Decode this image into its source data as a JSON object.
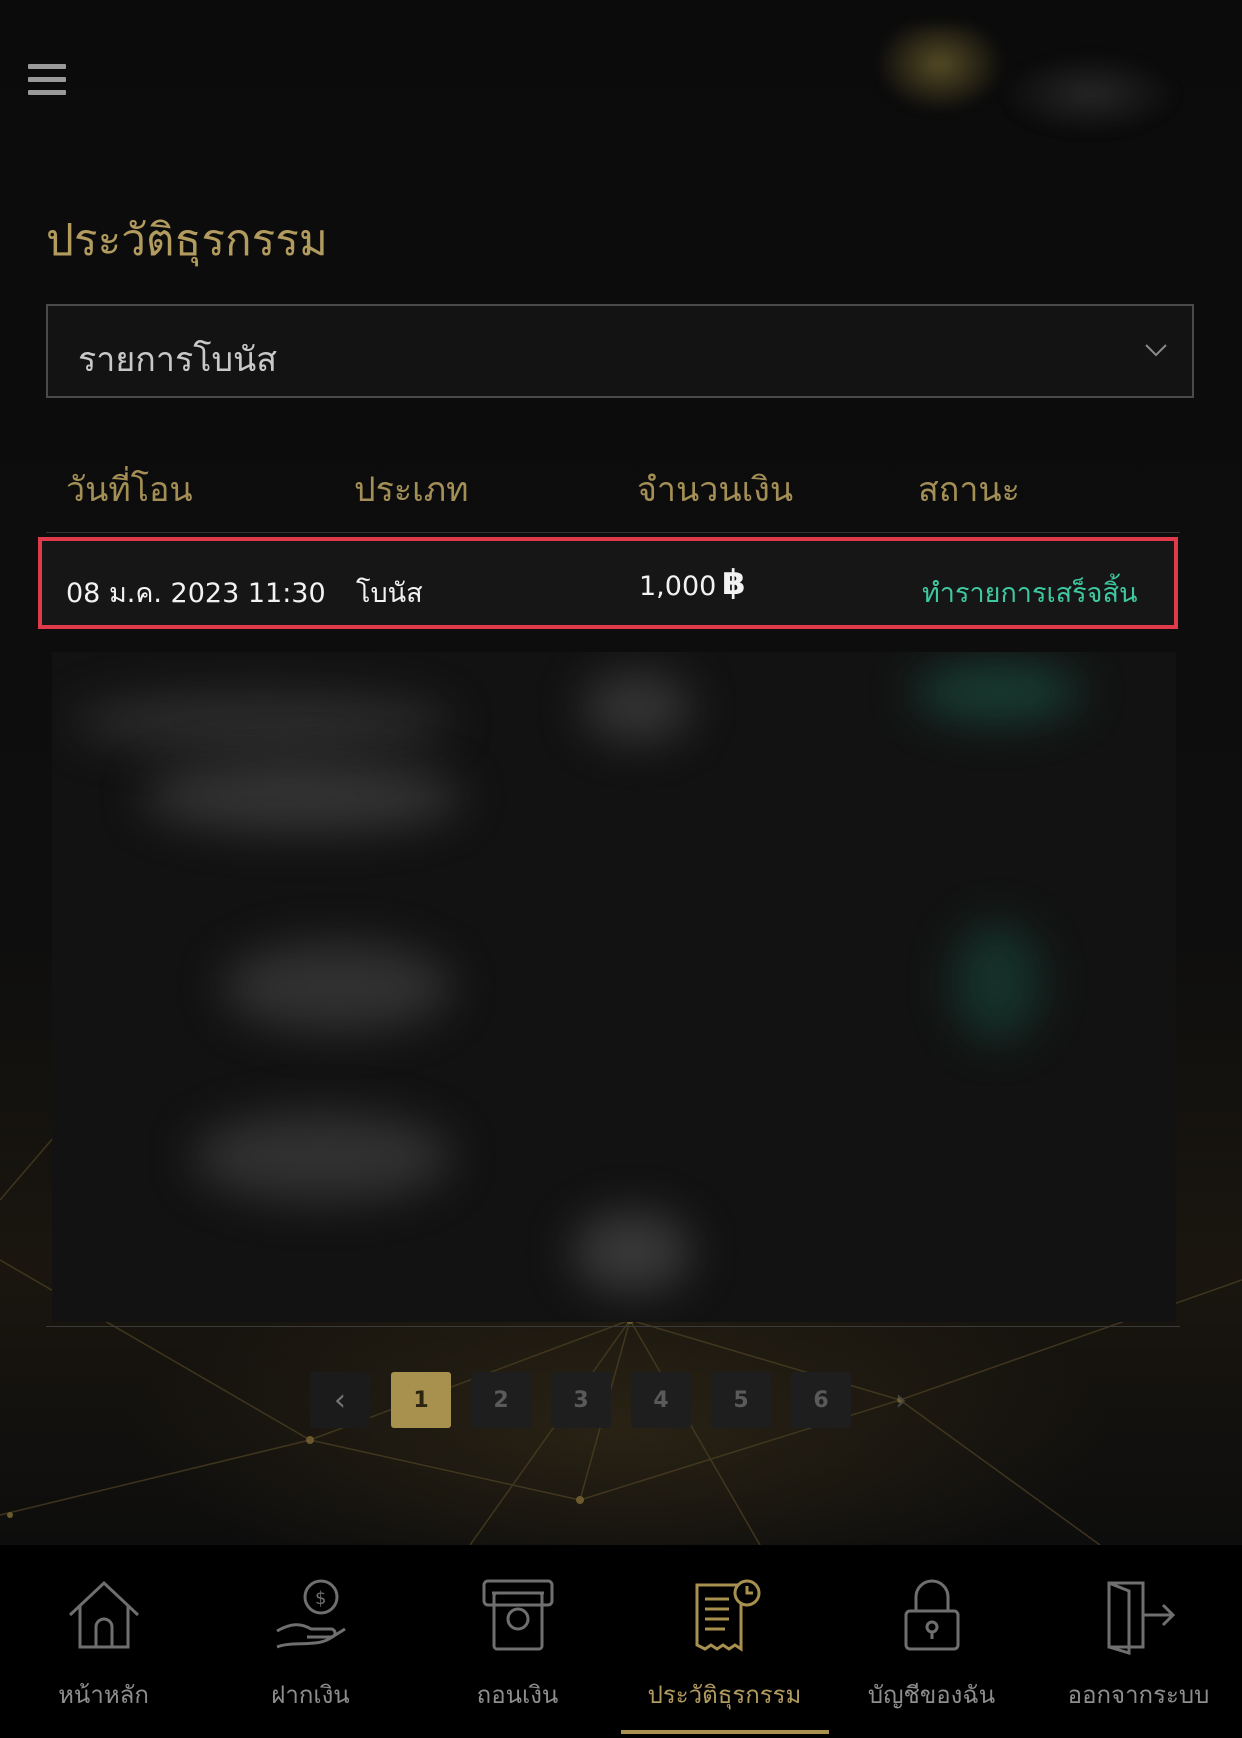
{
  "page_title": "ประวัติธุรกรรม",
  "filter": {
    "selected": "รายการโบนัส"
  },
  "table": {
    "headers": [
      "วันที่โอน",
      "ประเภท",
      "จำนวนเงิน",
      "สถานะ"
    ],
    "rows": [
      {
        "date": "08 ม.ค. 2023 11:30",
        "type": "โบนัส",
        "amount": "1,000",
        "currency": "฿",
        "status": "ทำรายการเสร็จสิ้น"
      }
    ]
  },
  "pagination": {
    "prev": "‹",
    "pages": [
      "1",
      "2",
      "3",
      "4",
      "5",
      "6"
    ],
    "current": "1",
    "next": "›"
  },
  "bottom_nav": [
    {
      "label": "หน้าหลัก",
      "icon": "home-icon"
    },
    {
      "label": "ฝากเงิน",
      "icon": "deposit-coin-hand-icon"
    },
    {
      "label": "ถอนเงิน",
      "icon": "withdraw-atm-icon"
    },
    {
      "label": "ประวัติธุรกรรม",
      "icon": "transaction-history-receipt-icon",
      "active": true
    },
    {
      "label": "บัญชีของฉัน",
      "icon": "account-lock-icon"
    },
    {
      "label": "ออกจากระบบ",
      "icon": "logout-door-icon"
    }
  ],
  "colors": {
    "gold": "#b29b5e",
    "status_success": "#3fc7a0",
    "highlight_border": "#e0394a",
    "background": "#0c0c0c"
  }
}
